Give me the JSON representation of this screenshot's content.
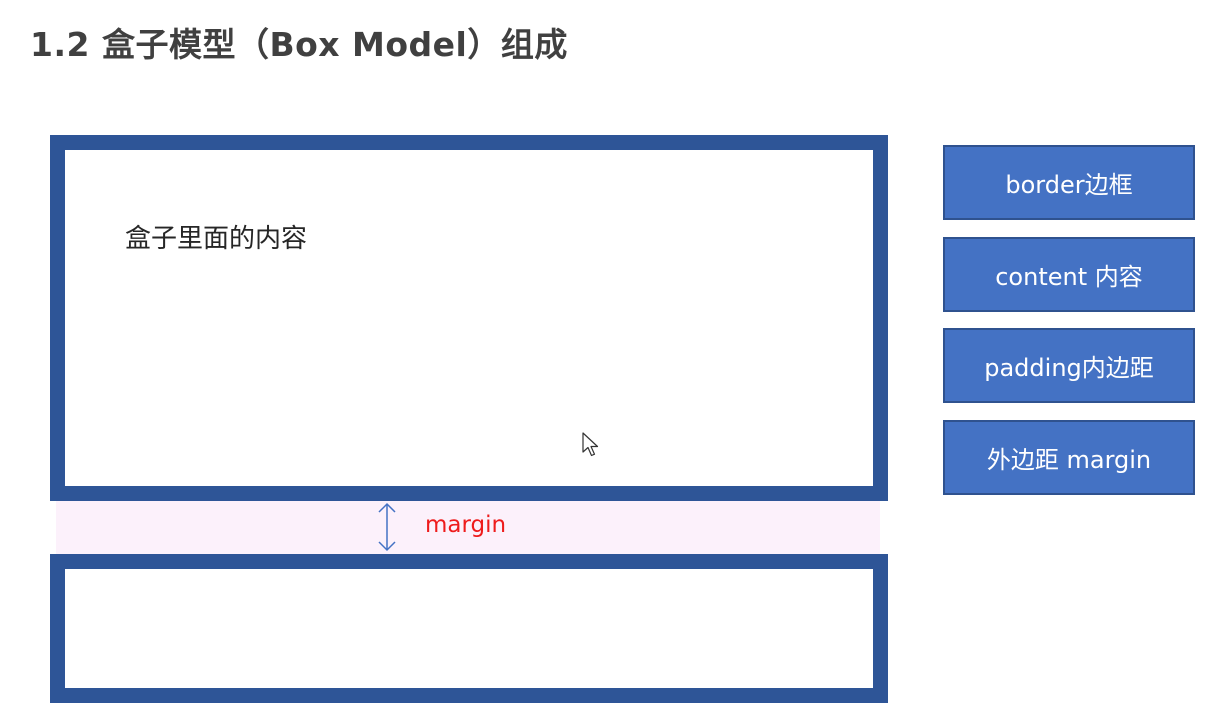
{
  "title": "1.2 盒子模型（Box Model）组成",
  "box": {
    "content_text": "盒子里面的内容"
  },
  "margin_label": "margin",
  "legend": [
    "border边框",
    "content 内容",
    "padding内边距",
    "外边距 margin"
  ],
  "colors": {
    "border": "#2e5597",
    "legend_fill": "#4472c4",
    "margin_fill": "#fcf1fb",
    "margin_text": "#ee1c1c"
  }
}
